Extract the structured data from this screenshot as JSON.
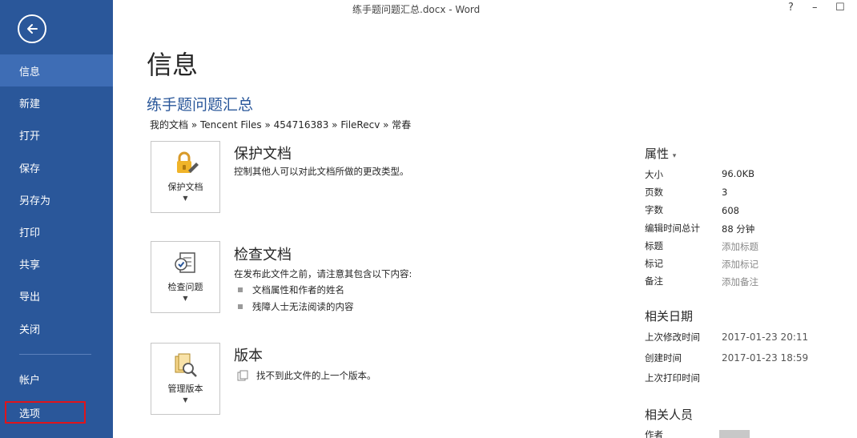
{
  "window": {
    "title": "练手题问题汇总.docx - Word",
    "help": "?",
    "minimize": "–",
    "maximize": "☐"
  },
  "sidebar": {
    "items": [
      {
        "label": "信息"
      },
      {
        "label": "新建"
      },
      {
        "label": "打开"
      },
      {
        "label": "保存"
      },
      {
        "label": "另存为"
      },
      {
        "label": "打印"
      },
      {
        "label": "共享"
      },
      {
        "label": "导出"
      },
      {
        "label": "关闭"
      },
      {
        "label": "帐户"
      },
      {
        "label": "选项"
      }
    ]
  },
  "main": {
    "page_title": "信息",
    "doc_title": "练手题问题汇总",
    "breadcrumb": "我的文档 » Tencent Files » 454716383 » FileRecv » 常春",
    "protect": {
      "button_label": "保护文档",
      "heading": "保护文档",
      "description": "控制其他人可以对此文档所做的更改类型。"
    },
    "inspect": {
      "button_label": "检查问题",
      "heading": "检查文档",
      "description": "在发布此文件之前，请注意其包含以下内容:",
      "bullets": [
        "文档属性和作者的姓名",
        "残障人士无法阅读的内容"
      ]
    },
    "versions": {
      "button_label": "管理版本",
      "heading": "版本",
      "description": "找不到此文件的上一个版本。"
    }
  },
  "properties": {
    "heading": "属性",
    "caret": "▾",
    "rows": [
      {
        "label": "大小",
        "value": "96.0KB"
      },
      {
        "label": "页数",
        "value": "3"
      },
      {
        "label": "字数",
        "value": "608"
      },
      {
        "label": "编辑时间总计",
        "value": "88 分钟"
      },
      {
        "label": "标题",
        "value": "添加标题"
      },
      {
        "label": "标记",
        "value": "添加标记"
      },
      {
        "label": "备注",
        "value": "添加备注"
      }
    ],
    "dates_heading": "相关日期",
    "dates": [
      {
        "label": "上次修改时间",
        "value": "2017-01-23 20:11"
      },
      {
        "label": "创建时间",
        "value": "2017-01-23 18:59"
      },
      {
        "label": "上次打印时间",
        "value": ""
      }
    ],
    "people_heading": "相关人员",
    "author_label": "作者"
  },
  "colors": {
    "sidebar": "#2a579a",
    "sidebar_active": "#3e6db5",
    "accent_title": "#2a579a",
    "highlight_box": "#e0141b"
  }
}
